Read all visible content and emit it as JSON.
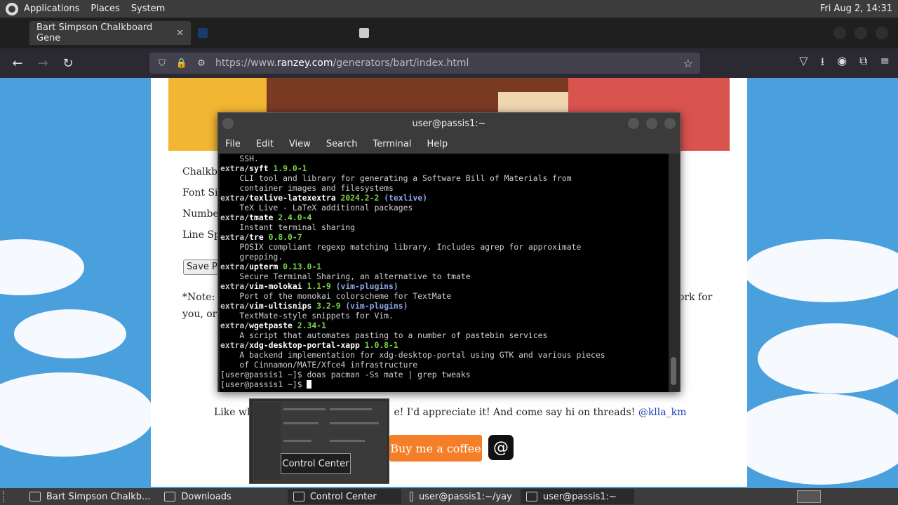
{
  "top_panel": {
    "menus": [
      "Applications",
      "Places",
      "System"
    ],
    "clock": "Fri Aug 2, 14:31"
  },
  "browser": {
    "tabs": [
      {
        "label": "Bart Simpson Chalkboard Gene",
        "active": true
      },
      {
        "label": "",
        "active": false
      },
      {
        "label": "",
        "active": false
      }
    ],
    "url_prefix": "https://www.",
    "url_domain": "ranzey.com",
    "url_path": "/generators/bart/index.html"
  },
  "page": {
    "labels": [
      "Chalkbo",
      "Font Si",
      "Number",
      "Line Sp"
    ],
    "save_button": "Save P",
    "note_left_1": "*Note:",
    "note_left_2": "you, or",
    "note_right": "ork for",
    "like_prefix": "Like wh",
    "like_suffix": "e! I'd appreciate it! And come say hi on threads!",
    "threads_handle": "@klla_km",
    "coffee_button": "Buy me a coffee"
  },
  "terminal": {
    "title": "user@passis1:~",
    "menu": [
      "File",
      "Edit",
      "View",
      "Search",
      "Terminal",
      "Help"
    ],
    "lines": [
      {
        "desc": "    SSH."
      },
      {
        "repo": "extra/",
        "pkg": "syft",
        "ver": " 1.9.0-1"
      },
      {
        "desc": "    CLI tool and library for generating a Software Bill of Materials from"
      },
      {
        "desc": "    container images and filesystems"
      },
      {
        "repo": "extra/",
        "pkg": "texlive-latexextra",
        "ver": " 2024.2-2",
        "grp": " (texlive)"
      },
      {
        "desc": "    TeX Live - LaTeX additional packages"
      },
      {
        "repo": "extra/",
        "pkg": "tmate",
        "ver": " 2.4.0-4"
      },
      {
        "desc": "    Instant terminal sharing"
      },
      {
        "repo": "extra/",
        "pkg": "tre",
        "ver": " 0.8.0-7"
      },
      {
        "desc": "    POSIX compliant regexp matching library. Includes agrep for approximate"
      },
      {
        "desc": "    grepping."
      },
      {
        "repo": "extra/",
        "pkg": "upterm",
        "ver": " 0.13.0-1"
      },
      {
        "desc": "    Secure Terminal Sharing, an alternative to tmate"
      },
      {
        "repo": "extra/",
        "pkg": "vim-molokai",
        "ver": " 1.1-9",
        "grp": " (vim-plugins)"
      },
      {
        "desc": "    Port of the monokai colorscheme for TextMate"
      },
      {
        "repo": "extra/",
        "pkg": "vim-ultisnips",
        "ver": " 3.2-9",
        "grp": " (vim-plugins)"
      },
      {
        "desc": "    TextMate-style snippets for Vim."
      },
      {
        "repo": "extra/",
        "pkg": "wgetpaste",
        "ver": " 2.34-1"
      },
      {
        "desc": "    A script that automates pasting to a number of pastebin services"
      },
      {
        "repo": "extra/",
        "pkg": "xdg-desktop-portal-xapp",
        "ver": " 1.0.8-1"
      },
      {
        "desc": "    A backend implementation for xdg-desktop-portal using GTK and various pieces"
      },
      {
        "desc": "    of Cinnamon/MATE/Xfce4 infrastructure"
      },
      {
        "prompt": "[user@passis1 ~]$ doas pacman -Ss mate | grep tweaks"
      },
      {
        "prompt": "[user@passis1 ~]$ ",
        "cursor": true
      }
    ]
  },
  "tooltip": "Control Center",
  "taskbar": {
    "items": [
      {
        "label": "Bart Simpson Chalkb...",
        "active": false
      },
      {
        "label": "Downloads",
        "active": false
      },
      {
        "label": "Control Center",
        "active": true
      },
      {
        "label": "user@passis1:~/yay",
        "active": false
      },
      {
        "label": "user@passis1:~",
        "active": true
      }
    ]
  },
  "colors": {
    "sky": "#4aa0dc",
    "coffee": "#f57f29",
    "terminal_bg": "#000000",
    "version_green": "#7bd34b",
    "group_blue": "#8fa6e8"
  }
}
